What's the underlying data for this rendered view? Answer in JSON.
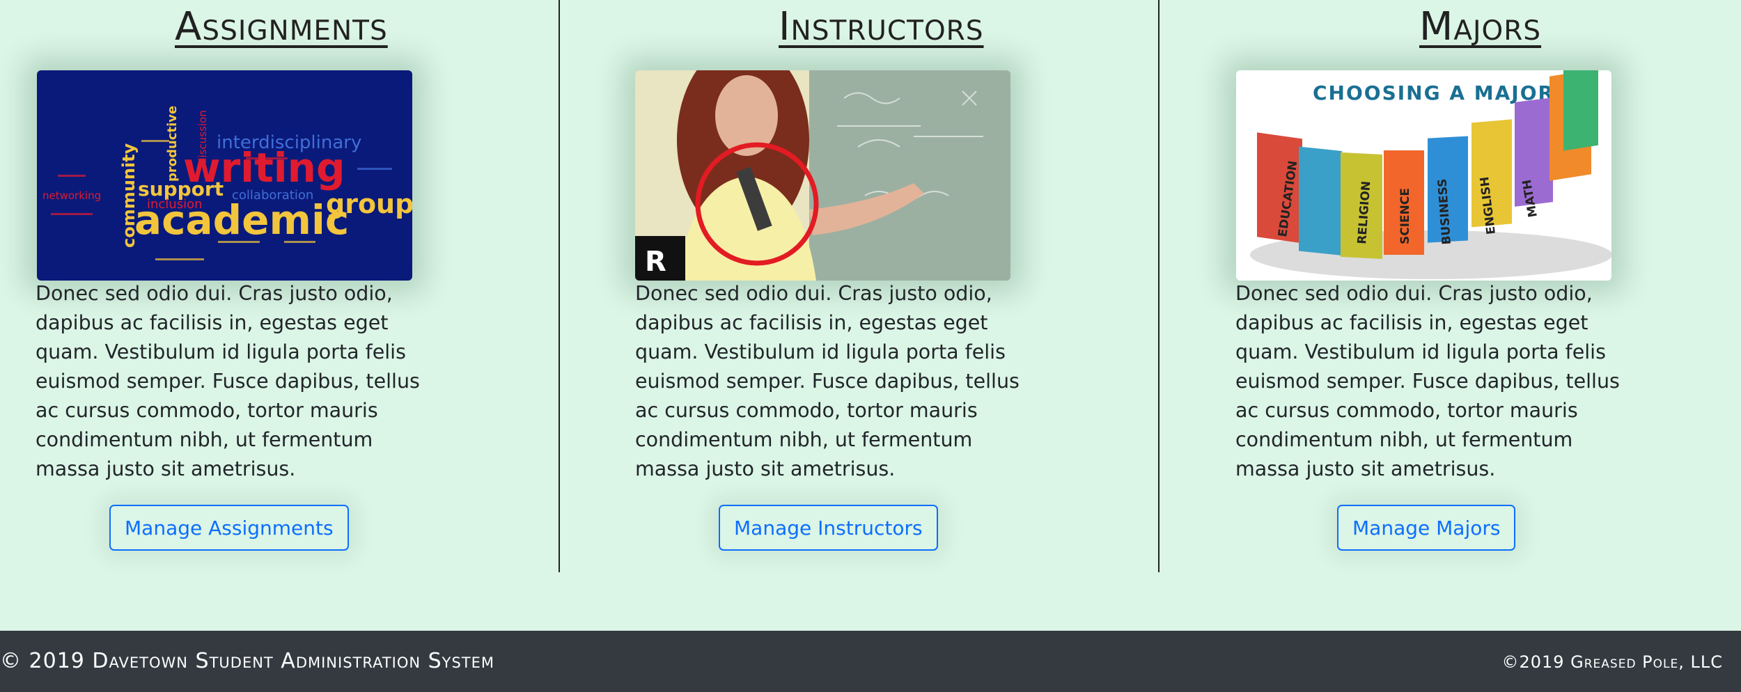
{
  "sections": [
    {
      "title": "Assignments",
      "image_icon": "word-cloud-image",
      "image_words": [
        "writing",
        "academic",
        "group",
        "support",
        "community",
        "interdisciplinary",
        "inclusion",
        "collaboration",
        "productive",
        "discussion",
        "networking"
      ],
      "description": "Donec sed odio dui. Cras justo odio, dapibus ac facilisis in, egestas eget quam. Vestibulum id ligula porta felis euismod semper. Fusce dapibus, tellus ac cursus commodo, tortor mauris condimentum nibh, ut fermentum massa justo sit ametrisus.",
      "button_label": "Manage Assignments"
    },
    {
      "title": "Instructors",
      "image_icon": "instructor-photo",
      "description": "Donec sed odio dui. Cras justo odio, dapibus ac facilisis in, egestas eget quam. Vestibulum id ligula porta felis euismod semper. Fusce dapibus, tellus ac cursus commodo, tortor mauris condimentum nibh, ut fermentum massa justo sit ametrisus.",
      "button_label": "Manage Instructors"
    },
    {
      "title": "Majors",
      "image_icon": "books-image",
      "image_caption": "CHOOSING A MAJOR",
      "book_labels": [
        "EDUCATION",
        "RELIGION",
        "SCIENCE",
        "BUSINESS",
        "ENGLISH",
        "MATH"
      ],
      "description": "Donec sed odio dui. Cras justo odio, dapibus ac facilisis in, egestas eget quam. Vestibulum id ligula porta felis euismod semper. Fusce dapibus, tellus ac cursus commodo, tortor mauris condimentum nibh, ut fermentum massa justo sit ametrisus.",
      "button_label": "Manage Majors"
    }
  ],
  "footer": {
    "left_text": "© 2019 Davetown Student Administration System",
    "right_text": "©2019 Greased Pole, LLC"
  },
  "colors": {
    "background": "#dbf5e6",
    "footer_bg": "#343a40",
    "button_accent": "#0d6efd"
  }
}
